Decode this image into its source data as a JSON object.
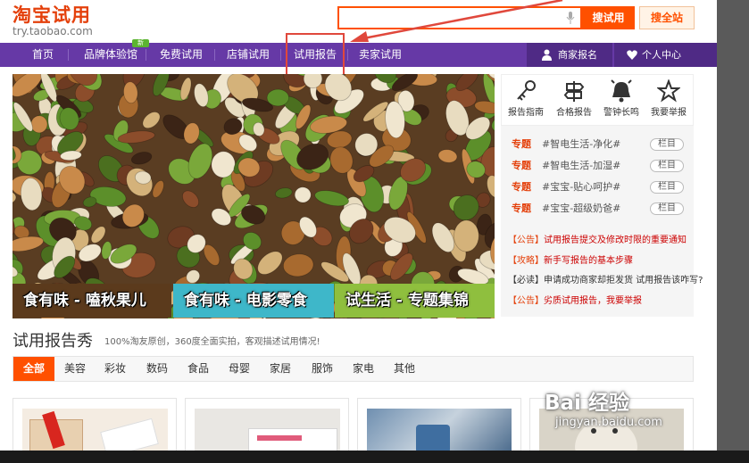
{
  "logo": {
    "title": "淘宝试用",
    "url": "try.taobao.com"
  },
  "search": {
    "button": "搜试用",
    "all_button": "搜全站"
  },
  "nav": {
    "items": [
      "首页",
      "品牌体验馆",
      "免费试用",
      "店铺试用",
      "试用报告",
      "卖家试用"
    ],
    "badge": "新",
    "merchant_signup": "商家报名",
    "personal_center": "个人中心"
  },
  "banner": {
    "captions": [
      "食有味 - 嗑秋果儿",
      "食有味 - 电影零食",
      "试生活 - 专题集锦"
    ]
  },
  "side": {
    "icons": [
      {
        "label": "报告指南",
        "icon": "key-icon"
      },
      {
        "label": "合格报告",
        "icon": "signpost-icon"
      },
      {
        "label": "警钟长鸣",
        "icon": "bell-icon"
      },
      {
        "label": "我要举报",
        "icon": "star-icon"
      }
    ],
    "topics": [
      {
        "tag": "专题",
        "text": "#智电生活-净化#",
        "button": "栏目"
      },
      {
        "tag": "专题",
        "text": "#智电生活-加湿#",
        "button": "栏目"
      },
      {
        "tag": "专题",
        "text": "#宝宝-贴心呵护#",
        "button": "栏目"
      },
      {
        "tag": "专题",
        "text": "#宝宝-超级奶爸#",
        "button": "栏目"
      }
    ],
    "notices": [
      {
        "tag": "【公告】",
        "text": "试用报告提交及修改时限的重要通知"
      },
      {
        "tag": "【攻略】",
        "text": "新手写报告的基本步骤"
      },
      {
        "tag": "【必读】",
        "text": "申请成功商家却拒发货 试用报告该咋写?"
      },
      {
        "tag": "【公告】",
        "text": "劣质试用报告，我要举报"
      }
    ]
  },
  "section": {
    "title": "试用报告秀",
    "subtitle": "100%淘友原创，360度全面实拍，客观描述试用情况!",
    "tabs": [
      "全部",
      "美容",
      "彩妆",
      "数码",
      "食品",
      "母婴",
      "家居",
      "服饰",
      "家电",
      "其他"
    ]
  },
  "watermark": {
    "brand": "Bai 经验",
    "url": "jingyan.baidu.com"
  },
  "colors": {
    "accent": "#ff5000",
    "nav": "#6639a6",
    "highlight": "#e0483c"
  }
}
